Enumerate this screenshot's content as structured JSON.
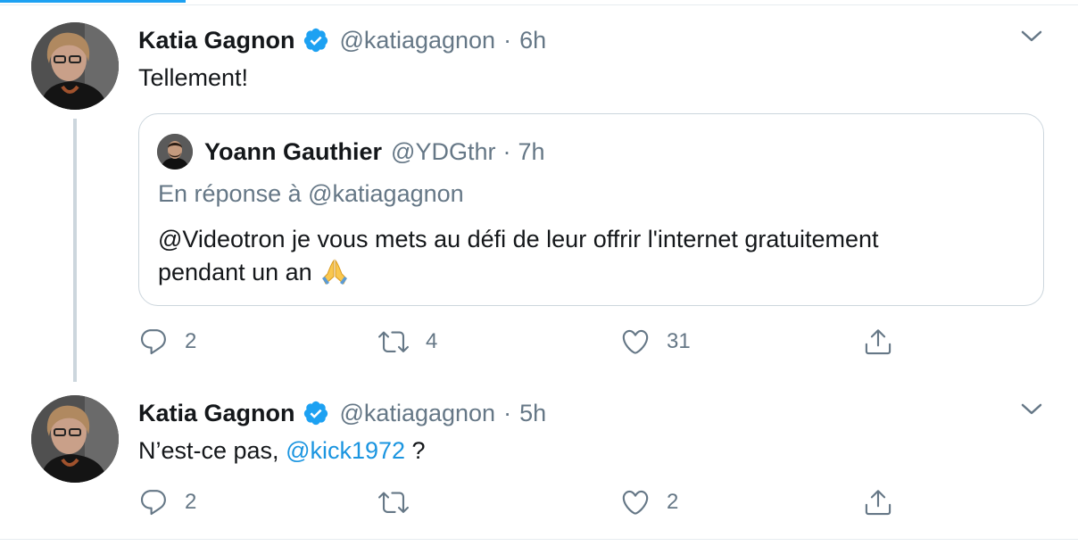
{
  "tweets": [
    {
      "author_name": "Katia Gagnon",
      "handle": "@katiagagnon",
      "separator": "·",
      "time": "6h",
      "text": "Tellement!",
      "quote": {
        "author_name": "Yoann Gauthier",
        "handle": "@YDGthr",
        "separator": "·",
        "time": "7h",
        "reply_to": "En réponse à @katiagagnon",
        "text_line1": "@Videotron je vous mets au défi de leur offrir l'internet gratuitement",
        "text_line2": "pendant un an"
      },
      "actions": {
        "replies": "2",
        "retweets": "4",
        "likes": "31"
      }
    },
    {
      "author_name": "Katia Gagnon",
      "handle": "@katiagagnon",
      "separator": "·",
      "time": "5h",
      "text_before": "N’est-ce pas, ",
      "mention": "@kick1972",
      "text_after": " ?",
      "actions": {
        "replies": "2",
        "retweets": "",
        "likes": "2"
      }
    }
  ],
  "colors": {
    "accent": "#1da1f2",
    "mention": "#1b95e0",
    "secondary_text": "#657786",
    "border": "#ccd6dd"
  },
  "icons": [
    "verified-badge-icon",
    "chevron-down-icon",
    "reply-icon",
    "retweet-icon",
    "like-icon",
    "share-icon",
    "folded-hands-emoji"
  ]
}
